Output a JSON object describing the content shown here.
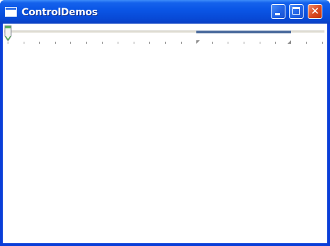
{
  "window": {
    "title": "ControlDemos",
    "icon": "window-icon"
  },
  "titlebar_buttons": {
    "minimize": "minimize-icon",
    "maximize": "maximize-icon",
    "close": "close-icon",
    "close_glyph": "✕"
  },
  "slider": {
    "minimum": 0,
    "maximum": 20,
    "value": 0,
    "tick_frequency": 1,
    "selection_start": 12,
    "selection_end": 18,
    "colors": {
      "selection": "#4a6a9c",
      "thumb": "#52b152",
      "track": "#e4e2d8"
    }
  }
}
